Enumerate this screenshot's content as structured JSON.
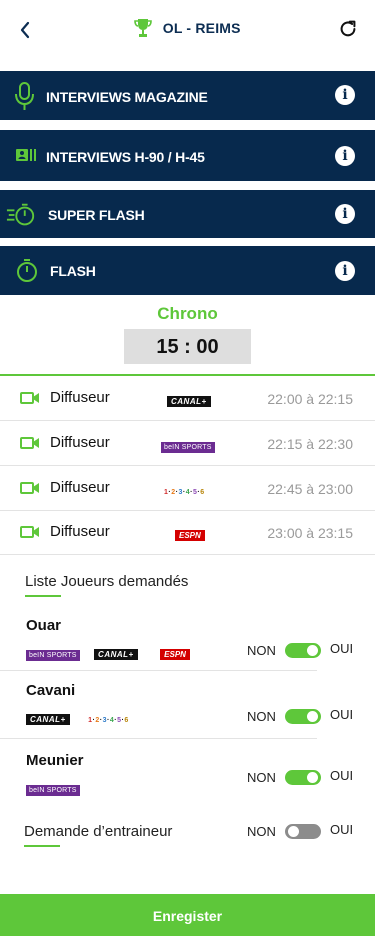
{
  "header": {
    "title": "OL - REIMS"
  },
  "sections": [
    {
      "label": "INTERVIEWS MAGAZINE",
      "icon": "microphone-icon"
    },
    {
      "label": "INTERVIEWS H-90 / H-45",
      "icon": "id-card-icon"
    },
    {
      "label": "SUPER FLASH",
      "icon": "stopwatch-fast-icon"
    },
    {
      "label": "FLASH",
      "icon": "stopwatch-icon"
    }
  ],
  "chrono": {
    "title": "Chrono",
    "value": "15 : 00"
  },
  "broadcasts": [
    {
      "label": "Diffuseur",
      "logo": "CANAL+",
      "time": "22:00 à 22:15"
    },
    {
      "label": "Diffuseur",
      "logo": "beIN SPORTS",
      "time": "22:15 à 22:30"
    },
    {
      "label": "Diffuseur",
      "logo": "beIN SPORTS MAX 1 2 3 4 5 6",
      "time": "22:45 à 23:00"
    },
    {
      "label": "Diffuseur",
      "logo": "ESPN",
      "time": "23:00 à 23:15"
    }
  ],
  "players_title": "Liste Joueurs demandés",
  "players": [
    {
      "name": "Ouar",
      "logos": [
        "beIN SPORTS",
        "CANAL+",
        "ESPN"
      ],
      "non": "NON",
      "oui": "OUI",
      "enabled": true
    },
    {
      "name": "Cavani",
      "logos": [
        "CANAL+",
        "beIN SPORTS MAX 1 2 3 4 5 6"
      ],
      "non": "NON",
      "oui": "OUI",
      "enabled": true
    },
    {
      "name": "Meunier",
      "logos": [
        "beIN SPORTS"
      ],
      "non": "NON",
      "oui": "OUI",
      "enabled": true
    }
  ],
  "coach": {
    "label": "Demande d’entraineur",
    "non": "NON",
    "oui": "OUI",
    "enabled": false
  },
  "save_label": "Enregister",
  "colors": {
    "navy": "#07294d",
    "green": "#5ec73a",
    "grey_time": "#9a9a9a"
  },
  "logo_text": {
    "canal": "CANAL+",
    "bein": "beIN SPORTS",
    "espn": "ESPN",
    "beinmax": [
      "1",
      "2",
      "3",
      "4",
      "5",
      "6"
    ]
  }
}
